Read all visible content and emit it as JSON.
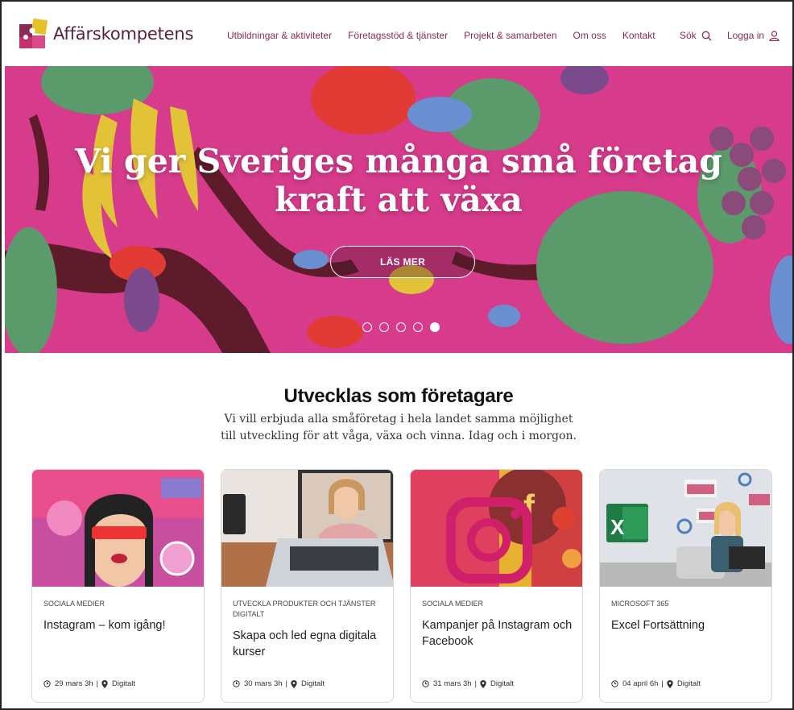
{
  "brand": {
    "name": "Affärskompetens"
  },
  "nav": {
    "items": [
      {
        "label": "Utbildningar & aktiviteter"
      },
      {
        "label": "Företagsstöd & tjänster"
      },
      {
        "label": "Projekt & samarbeten"
      },
      {
        "label": "Om oss"
      },
      {
        "label": "Kontakt"
      }
    ],
    "search_label": "Sök",
    "login_label": "Logga in"
  },
  "hero": {
    "title_line1": "Vi ger Sveriges många små företag",
    "title_line2": "kraft att växa",
    "button_label": "LÄS MER",
    "slides_total": 5,
    "active_slide": 5
  },
  "section": {
    "title": "Utvecklas som företagare",
    "subtitle": "Vi vill erbjuda alla småföretag i hela landet samma möjlighet till utveckling för att våga, växa och vinna. Idag och i morgon."
  },
  "cards": [
    {
      "category": "SOCIALA MEDIER",
      "title": "Instagram – kom igång!",
      "date": "29 mars",
      "duration": "3h",
      "location": "Digitalt"
    },
    {
      "category": "UTVECKLA PRODUKTER OCH TJÄNSTER DIGITALT",
      "title": "Skapa och led egna digitala kurser",
      "date": "30 mars",
      "duration": "3h",
      "location": "Digitalt"
    },
    {
      "category": "SOCIALA MEDIER",
      "title": "Kampanjer på Instagram och Facebook",
      "date": "31 mars",
      "duration": "3h",
      "location": "Digitalt"
    },
    {
      "category": "MICROSOFT 365",
      "title": "Excel Fortsättning",
      "date": "04 april",
      "duration": "6h",
      "location": "Digitalt"
    }
  ],
  "colors": {
    "brand": "#8b2a55",
    "hero_bg": "#d73b8b"
  },
  "icons": [
    "puzzle-logo-icon",
    "search-icon",
    "user-icon",
    "clock-icon",
    "location-pin-icon"
  ]
}
